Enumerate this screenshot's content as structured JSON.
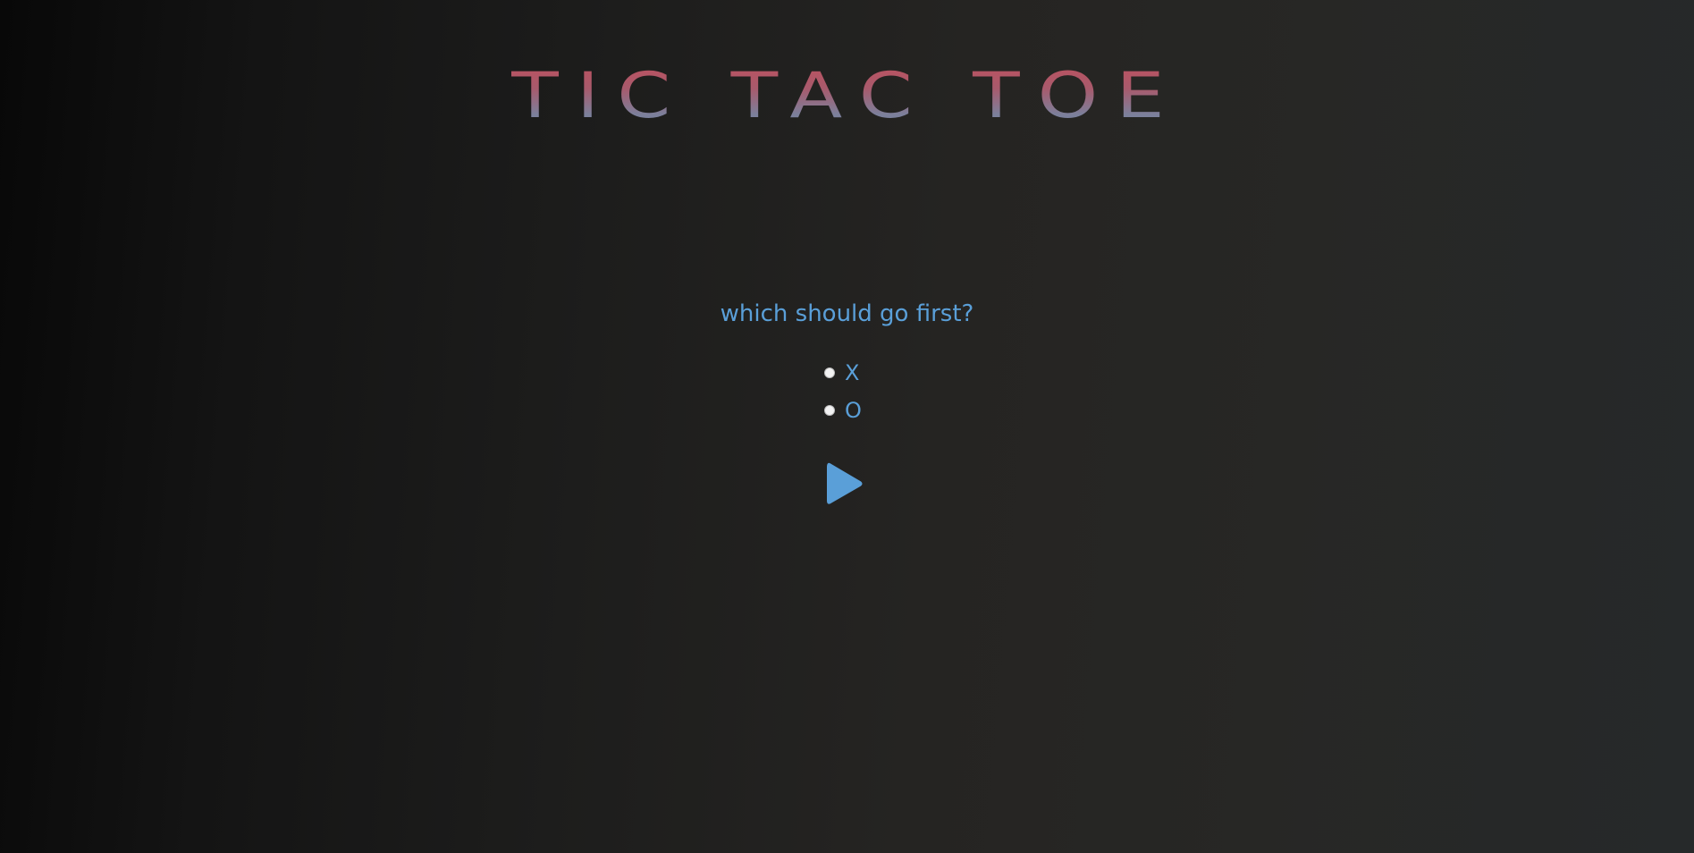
{
  "game": {
    "title": "TIC TAC TOE"
  },
  "setup": {
    "prompt": "which should go first?",
    "options": [
      {
        "label": "X",
        "selected": false
      },
      {
        "label": "O",
        "selected": false
      }
    ],
    "start_icon": "play-icon"
  },
  "colors": {
    "title_top": "#c0505d",
    "title_bottom": "#6f86a6",
    "accent": "#5a9fd8",
    "radio": "#f2f2f2"
  }
}
